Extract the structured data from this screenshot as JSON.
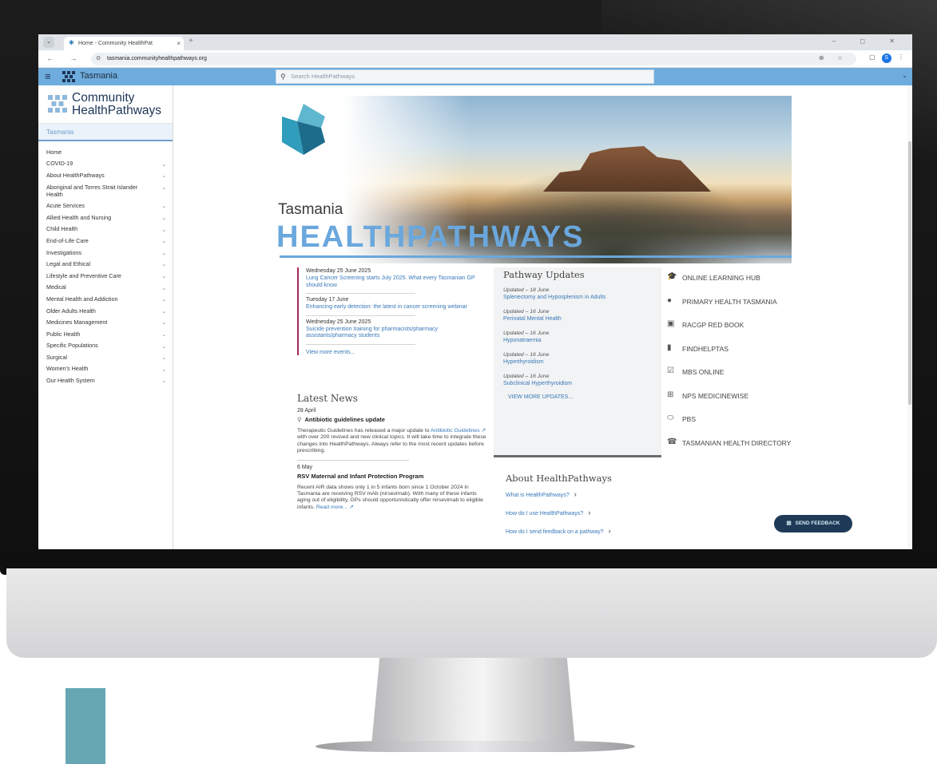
{
  "browser": {
    "tab_title": "Home - Community HealthPat",
    "tab_close": "×",
    "new_tab": "+",
    "url": "tasmania.communityhealthpathways.org",
    "nav_icons": "← → C",
    "window_controls": "– ◻ ✕",
    "omnibox_icons": "⊕ ☆",
    "profile_initial": "S"
  },
  "site_header": {
    "title": "Tasmania",
    "search_placeholder": "Search HealthPathways"
  },
  "sidebar": {
    "brand_line1": "Community",
    "brand_line2": "HealthPathways",
    "region": "Tasmania",
    "items": [
      {
        "label": "Home",
        "expandable": false
      },
      {
        "label": "COVID-19",
        "expandable": true
      },
      {
        "label": "About HealthPathways",
        "expandable": true
      },
      {
        "label": "Aboriginal and Torres Strait Islander Health",
        "expandable": true
      },
      {
        "label": "Acute Services",
        "expandable": true
      },
      {
        "label": "Allied Health and Nursing",
        "expandable": true
      },
      {
        "label": "Child Health",
        "expandable": true
      },
      {
        "label": "End-of-Life Care",
        "expandable": true
      },
      {
        "label": "Investigations",
        "expandable": true
      },
      {
        "label": "Legal and Ethical",
        "expandable": true
      },
      {
        "label": "Lifestyle and Preventive Care",
        "expandable": true
      },
      {
        "label": "Medical",
        "expandable": true
      },
      {
        "label": "Mental Health and Addiction",
        "expandable": true
      },
      {
        "label": "Older Adults Health",
        "expandable": true
      },
      {
        "label": "Medicines Management",
        "expandable": true
      },
      {
        "label": "Public Health",
        "expandable": true
      },
      {
        "label": "Specific Populations",
        "expandable": true
      },
      {
        "label": "Surgical",
        "expandable": true
      },
      {
        "label": "Women's Health",
        "expandable": true
      },
      {
        "label": "Our Health System",
        "expandable": true
      }
    ]
  },
  "hero": {
    "region": "Tasmania",
    "brand": "HEALTHPATHWAYS"
  },
  "events": {
    "items": [
      {
        "date": "Wednesday 25 June 2025",
        "title": "Lung Cancer Screening starts July 2025. What every Tasmanian GP should know"
      },
      {
        "date": "Tuesday 17 June",
        "title": "Enhancing early detection: the latest in cancer screening webinar"
      },
      {
        "date": "Wednesday 25 June 2025",
        "title": "Suicide prevention training for pharmacists/pharmacy assistants/pharmacy students"
      }
    ],
    "more_label": "View more events..."
  },
  "news": {
    "heading": "Latest News",
    "items": [
      {
        "date": "28 April",
        "title": "Antibiotic guidelines update",
        "body_before": "Therapeutic Guidelines has released a major update to",
        "link": "Antibiotic Guidelines ↗",
        "body_after": "with over 200 revised and new clinical topics. It will take time to integrate these changes into HealthPathways. Always refer to the most recent updates before prescribing."
      },
      {
        "date": "6 May",
        "title": "RSV Maternal and Infant Protection Program",
        "body_before": "Recent AIR data shows only 1 in 5 infants born since 1 October 2024 in Tasmania are receiving RSV mAb (nirsevimab). With many of these infants aging out of eligibility, GPs should opportunistically offer nirsevimab to eligible infants.",
        "link": "Read more... ↗",
        "body_after": ""
      }
    ]
  },
  "updates": {
    "heading": "Pathway Updates",
    "items": [
      {
        "date": "Updated – 18 June",
        "title": "Splenectomy and Hyposplenism in Adults"
      },
      {
        "date": "Updated – 16 June",
        "title": "Perinatal Mental Health"
      },
      {
        "date": "Updated – 16 June",
        "title": "Hyponatraemia"
      },
      {
        "date": "Updated – 16 June",
        "title": "Hyperthyroidism"
      },
      {
        "date": "Updated – 16 June",
        "title": "Subclinical Hyperthyroidism"
      }
    ],
    "more_label": "VIEW MORE UPDATES..."
  },
  "about": {
    "heading": "About HealthPathways",
    "links": [
      "What is HealthPathways?",
      "How do I use HealthPathways?",
      "How do I send feedback on a pathway?"
    ]
  },
  "quick_links": [
    {
      "label": "ONLINE LEARNING HUB",
      "icon": "graduation-cap-icon",
      "glyph": "🎓"
    },
    {
      "label": "PRIMARY HEALTH TASMANIA",
      "icon": "apple-icon",
      "glyph": "●"
    },
    {
      "label": "RACGP RED BOOK",
      "icon": "book-icon",
      "glyph": "▣"
    },
    {
      "label": "FINDHELPTAS",
      "icon": "bookmark-icon",
      "glyph": "▮"
    },
    {
      "label": "MBS ONLINE",
      "icon": "checkbox-icon",
      "glyph": "☑"
    },
    {
      "label": "NPS MEDICINEWISE",
      "icon": "medicine-box-icon",
      "glyph": "⊞"
    },
    {
      "label": "PBS",
      "icon": "pill-icon",
      "glyph": "⬭"
    },
    {
      "label": "TASMANIAN HEALTH DIRECTORY",
      "icon": "phone-directory-icon",
      "glyph": "☎"
    }
  ],
  "feedback": {
    "label": "SEND FEEDBACK"
  },
  "colors": {
    "header_blue": "#6eacdd",
    "brand_blue": "#6aa7dd",
    "link_blue": "#3879b8",
    "events_accent": "#a3285c",
    "feedback_navy": "#1e3a56",
    "logo_teal": "#5fb7cf",
    "logo_navy": "#1d6c8c"
  }
}
